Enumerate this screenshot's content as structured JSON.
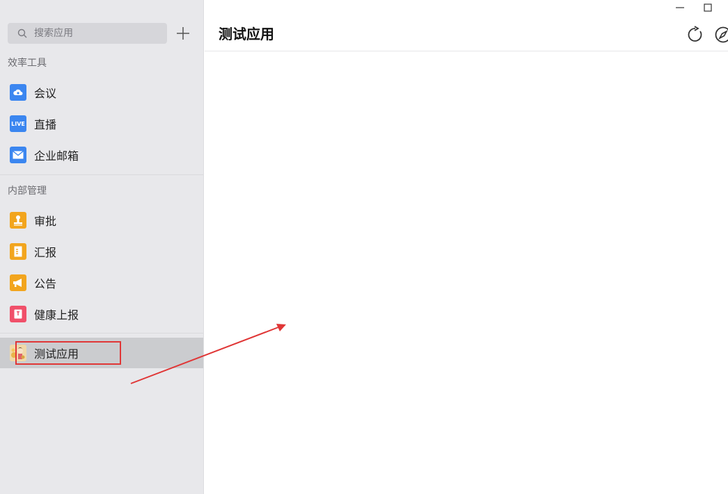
{
  "search": {
    "placeholder": "搜索应用"
  },
  "sections": {
    "efficiency": "效率工具",
    "internal": "内部管理"
  },
  "efficiency_items": [
    {
      "label": "会议",
      "icon": "cloud-meeting-icon",
      "color": "#3b86f0"
    },
    {
      "label": "直播",
      "icon": "live-icon",
      "color": "#3b86f0",
      "icon_text": "LIVE"
    },
    {
      "label": "企业邮箱",
      "icon": "mail-icon",
      "color": "#3b86f0"
    }
  ],
  "internal_items": [
    {
      "label": "审批",
      "icon": "stamp-icon",
      "color": "#f2a51e"
    },
    {
      "label": "汇报",
      "icon": "report-icon",
      "color": "#f2a51e"
    },
    {
      "label": "公告",
      "icon": "megaphone-icon",
      "color": "#f2a51e"
    },
    {
      "label": "健康上报",
      "icon": "health-report-icon",
      "color": "#f0506a"
    }
  ],
  "custom_items": [
    {
      "label": "测试应用",
      "icon": "test-app-avatar-icon",
      "active": true
    }
  ],
  "main": {
    "title": "测试应用"
  },
  "annotation": {
    "color": "#e03636"
  }
}
